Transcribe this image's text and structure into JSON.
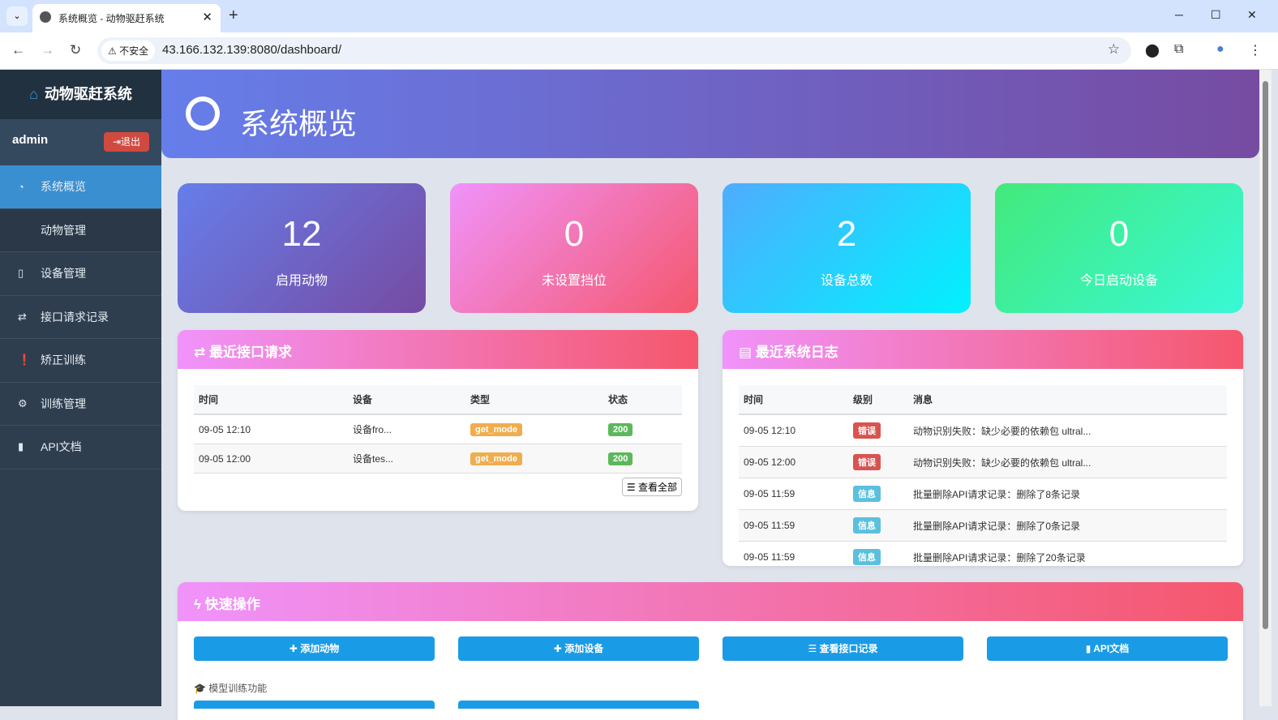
{
  "browser": {
    "tab_title": "系统概览 - 动物驱赶系统",
    "security_label": "不安全",
    "url": "43.166.132.139:8080/dashboard/"
  },
  "sidebar": {
    "brand": "动物驱赶系统",
    "username": "admin",
    "logout": "退出",
    "items": [
      {
        "label": "系统概览",
        "icon": "dashboard-icon"
      },
      {
        "label": "动物管理",
        "icon": ""
      },
      {
        "label": "设备管理",
        "icon": "mobile-icon"
      },
      {
        "label": "接口请求记录",
        "icon": "exchange-icon"
      },
      {
        "label": "矫正训练",
        "icon": "info-icon"
      },
      {
        "label": "训练管理",
        "icon": "gear-icon"
      },
      {
        "label": "API文档",
        "icon": "book-icon"
      }
    ]
  },
  "header": {
    "title": "系统概览"
  },
  "stats": [
    {
      "value": "12",
      "label": "启用动物"
    },
    {
      "value": "0",
      "label": "未设置挡位"
    },
    {
      "value": "2",
      "label": "设备总数"
    },
    {
      "value": "0",
      "label": "今日启动设备"
    }
  ],
  "requests": {
    "title": "最近接口请求",
    "columns": [
      "时间",
      "设备",
      "类型",
      "状态"
    ],
    "rows": [
      {
        "time": "09-05 12:10",
        "device": "设备fro...",
        "type": "get_mode",
        "status": "200"
      },
      {
        "time": "09-05 12:00",
        "device": "设备tes...",
        "type": "get_mode",
        "status": "200"
      }
    ],
    "view_all": "查看全部"
  },
  "logs": {
    "title": "最近系统日志",
    "columns": [
      "时间",
      "级别",
      "消息"
    ],
    "rows": [
      {
        "time": "09-05 12:10",
        "level": "错误",
        "message": "动物识别失败：缺少必要的依赖包 ultral..."
      },
      {
        "time": "09-05 12:00",
        "level": "错误",
        "message": "动物识别失败：缺少必要的依赖包 ultral..."
      },
      {
        "time": "09-05 11:59",
        "level": "信息",
        "message": "批量删除API请求记录：删除了8条记录"
      },
      {
        "time": "09-05 11:59",
        "level": "信息",
        "message": "批量删除API请求记录：删除了0条记录"
      },
      {
        "time": "09-05 11:59",
        "level": "信息",
        "message": "批量删除API请求记录：删除了20条记录"
      }
    ]
  },
  "quick": {
    "title": "快速操作",
    "buttons": [
      "添加动物",
      "添加设备",
      "查看接口记录",
      "API文档"
    ],
    "training_label": "模型训练功能"
  },
  "colors": {
    "error": "#d9534f",
    "info": "#5bc0de",
    "warning": "#f0ad4e",
    "success": "#5cb85c",
    "button": "#1a9be6"
  }
}
